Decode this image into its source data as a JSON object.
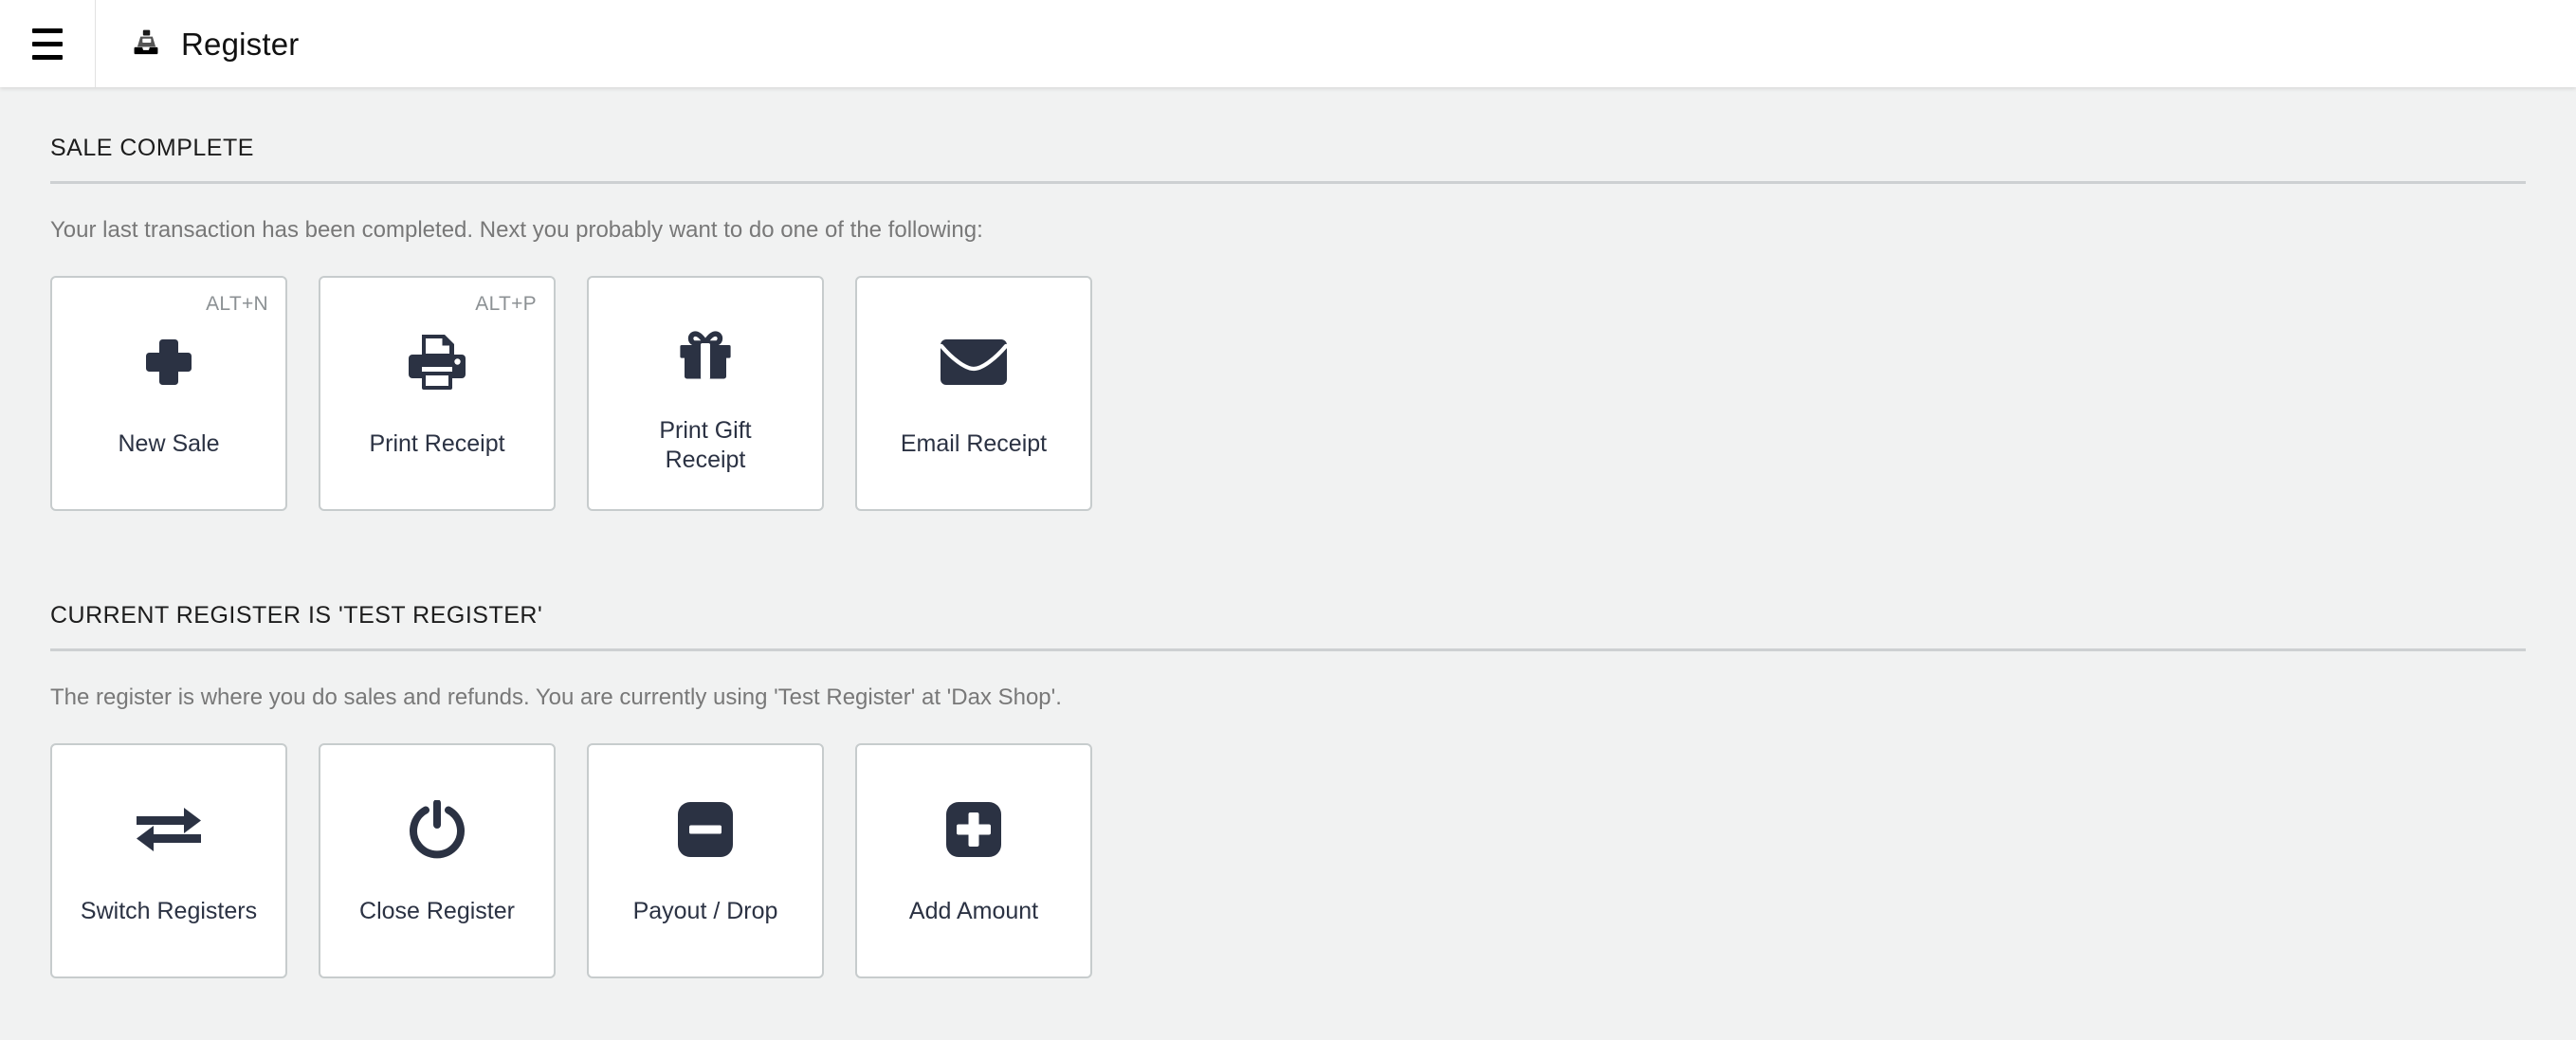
{
  "header": {
    "menu_icon": "hamburger-menu-icon",
    "app_icon": "cash-register-icon",
    "title": "Register"
  },
  "colors": {
    "page_background": "#f1f2f2",
    "header_background": "#ffffff",
    "card_background": "#ffffff",
    "card_border": "#c7cccd",
    "icon_dark": "#2b3243",
    "heading_text": "#1d1d1d",
    "body_text": "#787878",
    "shortcut_text": "#8c9194",
    "rule": "#cdd0d2"
  },
  "sections": [
    {
      "heading": "SALE COMPLETE",
      "description": "Your last transaction has been completed. Next you probably want to do one of the following:",
      "cards": [
        {
          "label": "New Sale",
          "shortcut": "ALT+N",
          "icon": "plus-icon"
        },
        {
          "label": "Print Receipt",
          "shortcut": "ALT+P",
          "icon": "printer-icon"
        },
        {
          "label": "Print Gift\nReceipt",
          "shortcut": "",
          "icon": "gift-icon"
        },
        {
          "label": "Email Receipt",
          "shortcut": "",
          "icon": "envelope-icon"
        }
      ]
    },
    {
      "heading": "CURRENT REGISTER IS 'TEST REGISTER'",
      "description": "The register is where you do sales and refunds. You are currently using 'Test Register'  at 'Dax Shop'.",
      "cards": [
        {
          "label": "Switch Registers",
          "shortcut": "",
          "icon": "exchange-arrows-icon"
        },
        {
          "label": "Close Register",
          "shortcut": "",
          "icon": "power-icon"
        },
        {
          "label": "Payout / Drop",
          "shortcut": "",
          "icon": "minus-square-icon"
        },
        {
          "label": "Add Amount",
          "shortcut": "",
          "icon": "plus-square-icon"
        }
      ]
    }
  ]
}
